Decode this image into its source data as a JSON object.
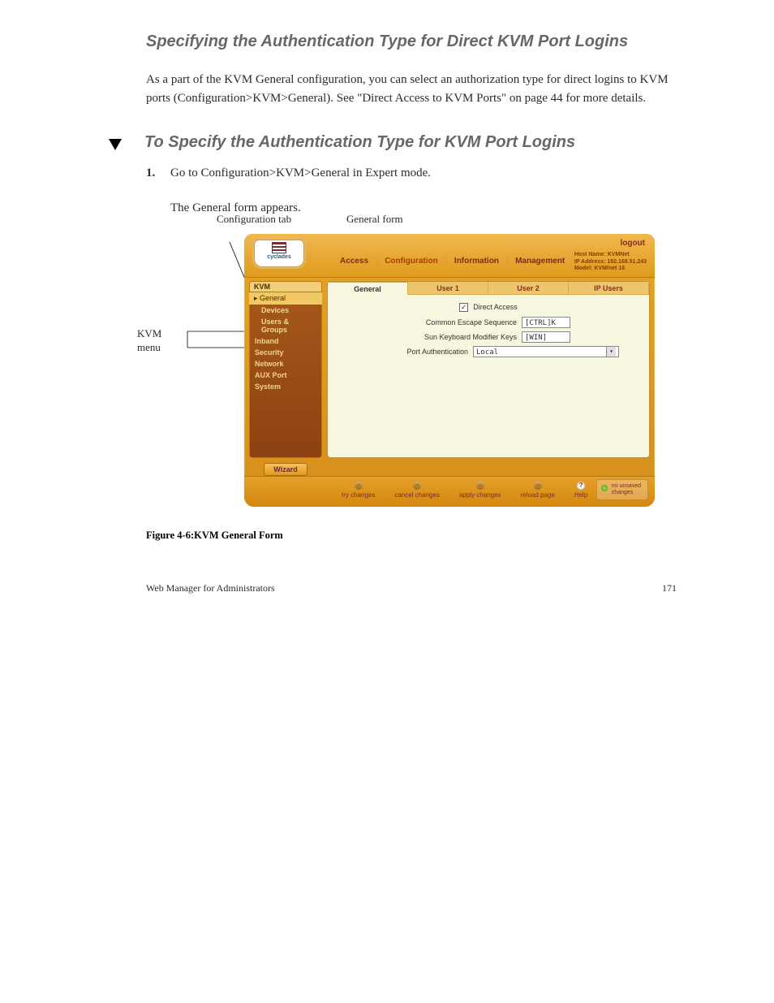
{
  "section": {
    "title": "Specifying the Authentication Type for Direct KVM Port Logins",
    "intro": "As a part of the KVM General configuration, you can select an authorization type for direct logins to KVM ports (Configuration>KVM>General). See \"Direct Access to KVM Ports\" on page 44 for more details.",
    "proc_title": "To Specify the Authentication Type for KVM Port Logins",
    "steps": [
      "Go to Configuration>KVM>General in Expert mode.",
      "The General form appears."
    ]
  },
  "callouts": {
    "c1": "KVM menu",
    "c2": "Configuration tab",
    "c3": "General form"
  },
  "screenshot": {
    "logo": "cyclades",
    "logout": "logout",
    "nav": {
      "items": [
        "Access",
        "Configuration",
        "Information",
        "Management"
      ],
      "active": "Configuration",
      "sep": "|"
    },
    "hostinfo": {
      "l1": "Host Name: KVMNet",
      "l2": "IP Address: 192.168.51.243",
      "l3": "Model: KVM/net 16"
    },
    "left": {
      "header": "KVM",
      "selected": "General",
      "subs": [
        "Devices",
        "Users & Groups"
      ],
      "items": [
        "Inband",
        "Security",
        "Network",
        "AUX Port",
        "System"
      ]
    },
    "tabs": [
      "General",
      "User 1",
      "User 2",
      "IP Users"
    ],
    "active_tab": "General",
    "form": {
      "direct_label": "Direct Access",
      "direct_checked": true,
      "esc_label": "Common Escape Sequence",
      "esc_value": "[CTRL]K",
      "sun_label": "Sun Keyboard Modifier Keys",
      "sun_value": "[WIN]",
      "auth_label": "Port Authentication",
      "auth_value": "Local"
    },
    "wizard": "Wizard",
    "footer": {
      "buttons": [
        "try changes",
        "cancel changes",
        "apply changes",
        "reload page",
        "Help"
      ],
      "unsaved_l1": "no unsaved",
      "unsaved_l2": "changes"
    }
  },
  "caption": "Figure 4-6:KVM General Form",
  "page": {
    "left": "Web Manager for Administrators",
    "right": "171"
  }
}
